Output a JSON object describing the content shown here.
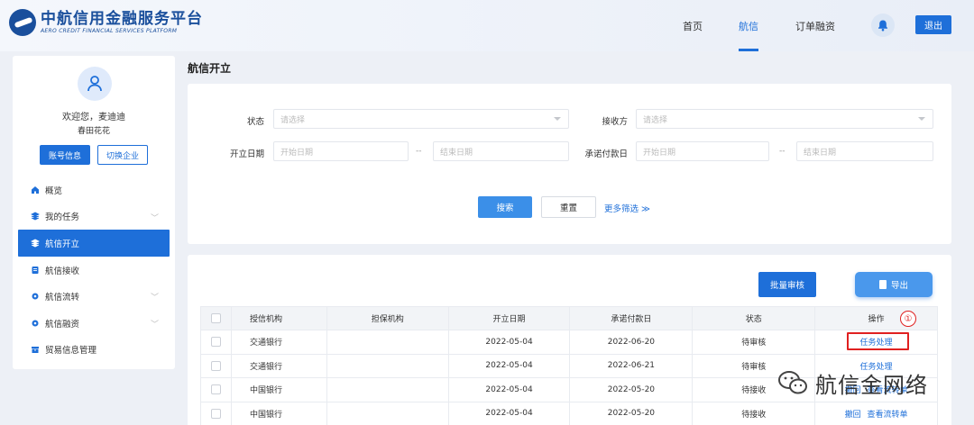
{
  "brand": {
    "title_cn": "中航信用金融服务平台",
    "title_en": "AERO CREDIT FINANCIAL SERVICES PLATFORM",
    "color": "#1a4f9c"
  },
  "nav": {
    "items": [
      "首页",
      "航信",
      "订单融资"
    ],
    "active_index": 1,
    "logout_label": "退出",
    "bell_icon": "bell-icon"
  },
  "sidebar": {
    "welcome": "欢迎您，麦迪迪",
    "company": "春田花花",
    "account_btn": "账号信息",
    "switch_btn": "切换企业",
    "items": [
      {
        "label": "概览",
        "icon": "home-icon",
        "has_chevron": false
      },
      {
        "label": "我的任务",
        "icon": "layers-icon",
        "has_chevron": true
      },
      {
        "label": "航信开立",
        "icon": "layers-icon",
        "has_chevron": false,
        "active": true
      },
      {
        "label": "航信接收",
        "icon": "document-icon",
        "has_chevron": false
      },
      {
        "label": "航信流转",
        "icon": "gear-icon",
        "has_chevron": true
      },
      {
        "label": "航信融资",
        "icon": "gear-icon",
        "has_chevron": true
      },
      {
        "label": "贸易信息管理",
        "icon": "archive-icon",
        "has_chevron": false
      }
    ]
  },
  "page": {
    "title": "航信开立"
  },
  "filters": {
    "status_label": "状态",
    "status_placeholder": "请选择",
    "receiver_label": "接收方",
    "receiver_placeholder": "请选择",
    "open_date_label": "开立日期",
    "open_start_placeholder": "开始日期",
    "open_end_placeholder": "结束日期",
    "pay_date_label": "承诺付款日",
    "pay_start_placeholder": "开始日期",
    "pay_end_placeholder": "结束日期",
    "range_sep": "--",
    "search_btn": "搜索",
    "reset_btn": "重置",
    "more_filter": "更多筛选 ≫"
  },
  "toolbar": {
    "batch_btn": "批量审核",
    "export_btn": "导出"
  },
  "table": {
    "columns": [
      "授信机构",
      "担保机构",
      "开立日期",
      "承诺付款日",
      "状态",
      "操作"
    ],
    "rows": [
      {
        "credit_org": "交通银行",
        "guarantor": "",
        "open_date": "2022-05-04",
        "pay_date": "2022-06-20",
        "status": "待审核",
        "actions": [
          "任务处理"
        ]
      },
      {
        "credit_org": "交通银行",
        "guarantor": "",
        "open_date": "2022-05-04",
        "pay_date": "2022-06-21",
        "status": "待审核",
        "actions": [
          "任务处理"
        ]
      },
      {
        "credit_org": "中国银行",
        "guarantor": "",
        "open_date": "2022-05-04",
        "pay_date": "2022-05-20",
        "status": "待接收",
        "actions": [
          "撤回",
          "查看流转单"
        ]
      },
      {
        "credit_org": "中国银行",
        "guarantor": "",
        "open_date": "2022-05-04",
        "pay_date": "2022-05-20",
        "status": "待接收",
        "actions": [
          "撤回",
          "查看流转单"
        ]
      }
    ]
  },
  "annotation": {
    "marker": "①",
    "color": "#e02020"
  },
  "watermark": {
    "text": "航信金网络"
  }
}
